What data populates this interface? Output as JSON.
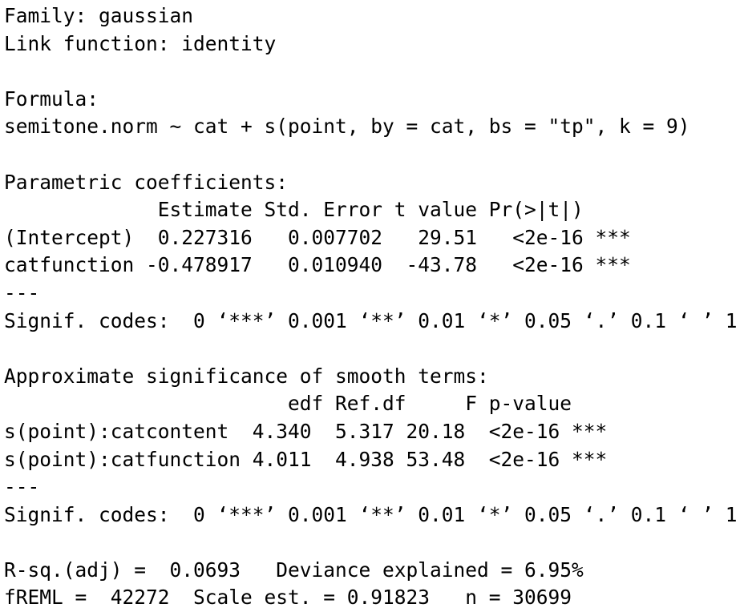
{
  "summary": {
    "family": "Family: gaussian",
    "link": "Link function: identity",
    "formula_header": "Formula:",
    "formula": "semitone.norm ~ cat + s(point, by = cat, bs = \"tp\", k = 9)",
    "parametric": {
      "header": "Parametric coefficients:",
      "columns": "             Estimate Std. Error t value Pr(>|t|)",
      "rows": [
        "(Intercept)  0.227316   0.007702   29.51   <2e-16 ***",
        "catfunction -0.478917   0.010940  -43.78   <2e-16 ***"
      ],
      "separator": "---",
      "signif": "Signif. codes:  0 ‘***’ 0.001 ‘**’ 0.01 ‘*’ 0.05 ‘.’ 0.1 ‘ ’ 1"
    },
    "smooth": {
      "header": "Approximate significance of smooth terms:",
      "columns": "                        edf Ref.df     F p-value",
      "rows": [
        "s(point):catcontent  4.340  5.317 20.18  <2e-16 ***",
        "s(point):catfunction 4.011  4.938 53.48  <2e-16 ***"
      ],
      "separator": "---",
      "signif": "Signif. codes:  0 ‘***’ 0.001 ‘**’ 0.01 ‘*’ 0.05 ‘.’ 0.1 ‘ ’ 1"
    },
    "fit": {
      "rsq_line": "R-sq.(adj) =  0.0693   Deviance explained = 6.95%",
      "freml_line": "fREML =  42272  Scale est. = 0.91823   n = 30699"
    }
  }
}
